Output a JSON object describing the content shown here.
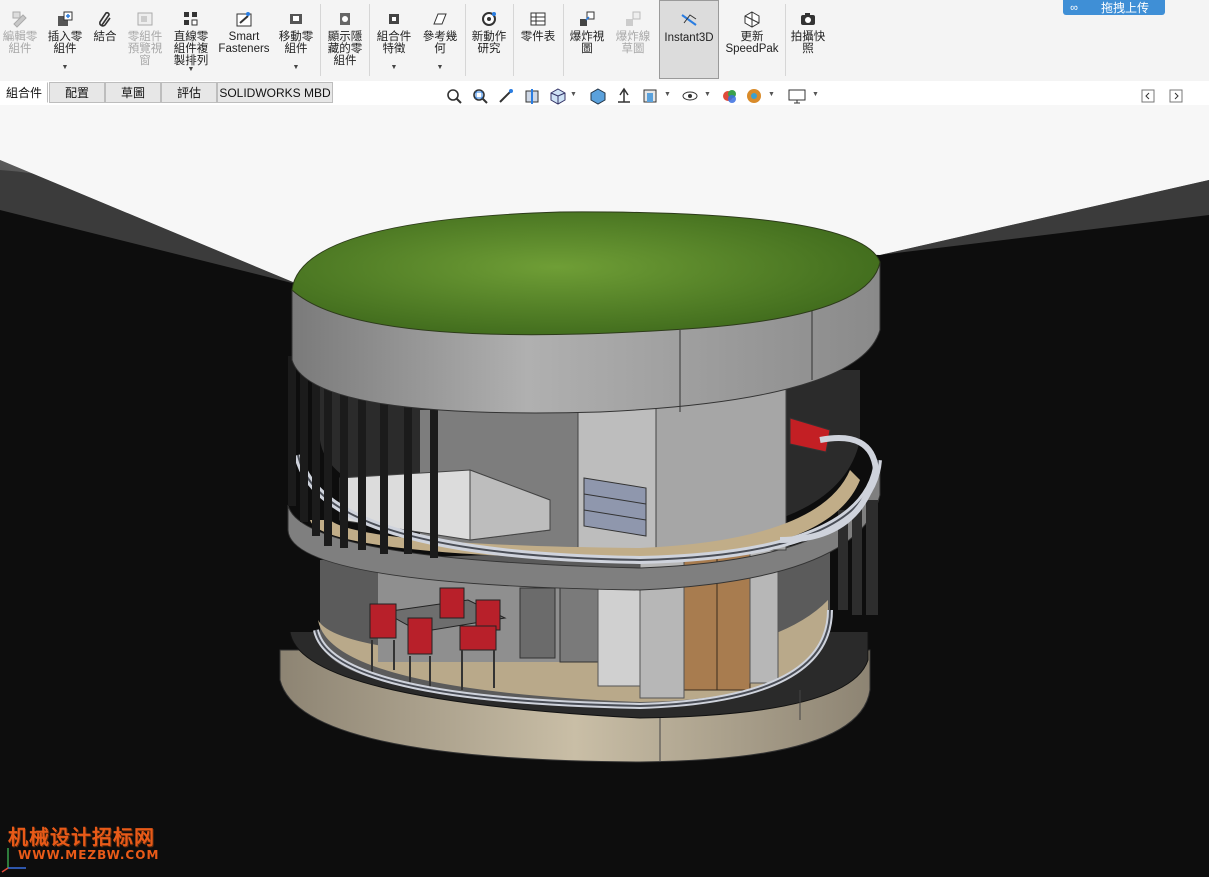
{
  "ribbon": {
    "buttons": [
      {
        "label": "編輯零\n組件",
        "icon": "edit-component-icon",
        "disabled": true
      },
      {
        "label": "插入零\n組件",
        "icon": "insert-component-icon",
        "dropdown": true
      },
      {
        "label": "結合",
        "icon": "mate-paperclip-icon"
      },
      {
        "label": "零組件\n預覽視\n窗",
        "icon": "component-preview-icon",
        "disabled": true
      },
      {
        "label": "直線零\n組件複\n製排列",
        "icon": "linear-pattern-icon",
        "dropdown": true
      },
      {
        "label": "Smart\nFasteners",
        "icon": "smart-fasteners-icon"
      },
      {
        "label": "移動零\n組件",
        "icon": "move-component-icon",
        "dropdown": true
      },
      {
        "label": "顯示隱\n藏的零\n組件",
        "icon": "show-hidden-icon"
      },
      {
        "label": "組合件\n特徵",
        "icon": "assembly-features-icon",
        "dropdown": true
      },
      {
        "label": "參考幾\n何",
        "icon": "reference-geometry-icon",
        "dropdown": true
      },
      {
        "label": "新動作\n研究",
        "icon": "motion-study-icon"
      },
      {
        "label": "零件表",
        "icon": "bom-icon"
      },
      {
        "label": "爆炸視\n圖",
        "icon": "exploded-view-icon"
      },
      {
        "label": "爆炸線\n草圖",
        "icon": "explode-line-sketch-icon",
        "disabled": true
      },
      {
        "label": "Instant3D",
        "icon": "instant3d-icon",
        "active": true
      },
      {
        "label": "更新\nSpeedPak",
        "icon": "speedpak-icon"
      },
      {
        "label": "拍攝快\n照",
        "icon": "camera-icon"
      }
    ],
    "upload_label": "拖拽上传"
  },
  "tabs": [
    {
      "label": "組合件",
      "active": true
    },
    {
      "label": "配置"
    },
    {
      "label": "草圖"
    },
    {
      "label": "評估"
    },
    {
      "label": "SOLIDWORKS MBD"
    }
  ],
  "view_toolbar": {
    "icons": [
      "zoom-to-fit-icon",
      "zoom-area-icon",
      "previous-view-icon",
      "section-view-icon",
      "view-orientation-icon",
      "display-style-icon",
      "hide-show-items-icon",
      "edit-appearance-icon",
      "apply-scene-icon",
      "view-settings-icon",
      "monitor-icon"
    ]
  },
  "watermark": {
    "line1": "机械设计招标网",
    "line2": "WWW.MEZBW.COM"
  },
  "colors": {
    "ribbon_bg": "#f4f4f4",
    "accent_blue": "#3f8fd6",
    "grass": "#5e8e2c",
    "wall_gray": "#a6a6a6",
    "floor_wood": "#9a7d5b",
    "chair_red": "#b8202a",
    "watermark_orange": "#e85a18"
  }
}
